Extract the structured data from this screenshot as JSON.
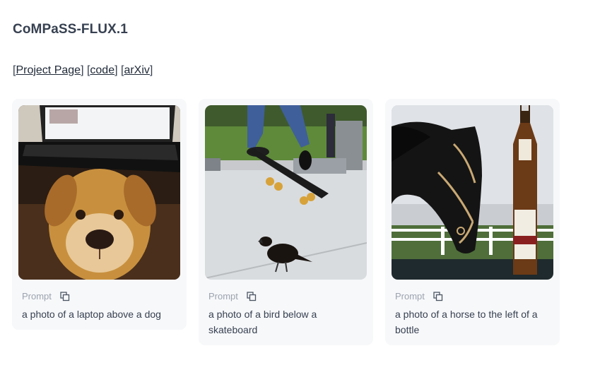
{
  "header": {
    "title": "CoMPaSS-FLUX.1"
  },
  "links": {
    "project_page": "Project Page",
    "code": "code",
    "arxiv": "arXiv"
  },
  "gallery": {
    "prompt_label": "Prompt",
    "cards": [
      {
        "prompt": "a photo of a laptop above a dog"
      },
      {
        "prompt": "a photo of a bird below a skateboard"
      },
      {
        "prompt": "a photo of a horse to the left of a bottle"
      }
    ]
  }
}
